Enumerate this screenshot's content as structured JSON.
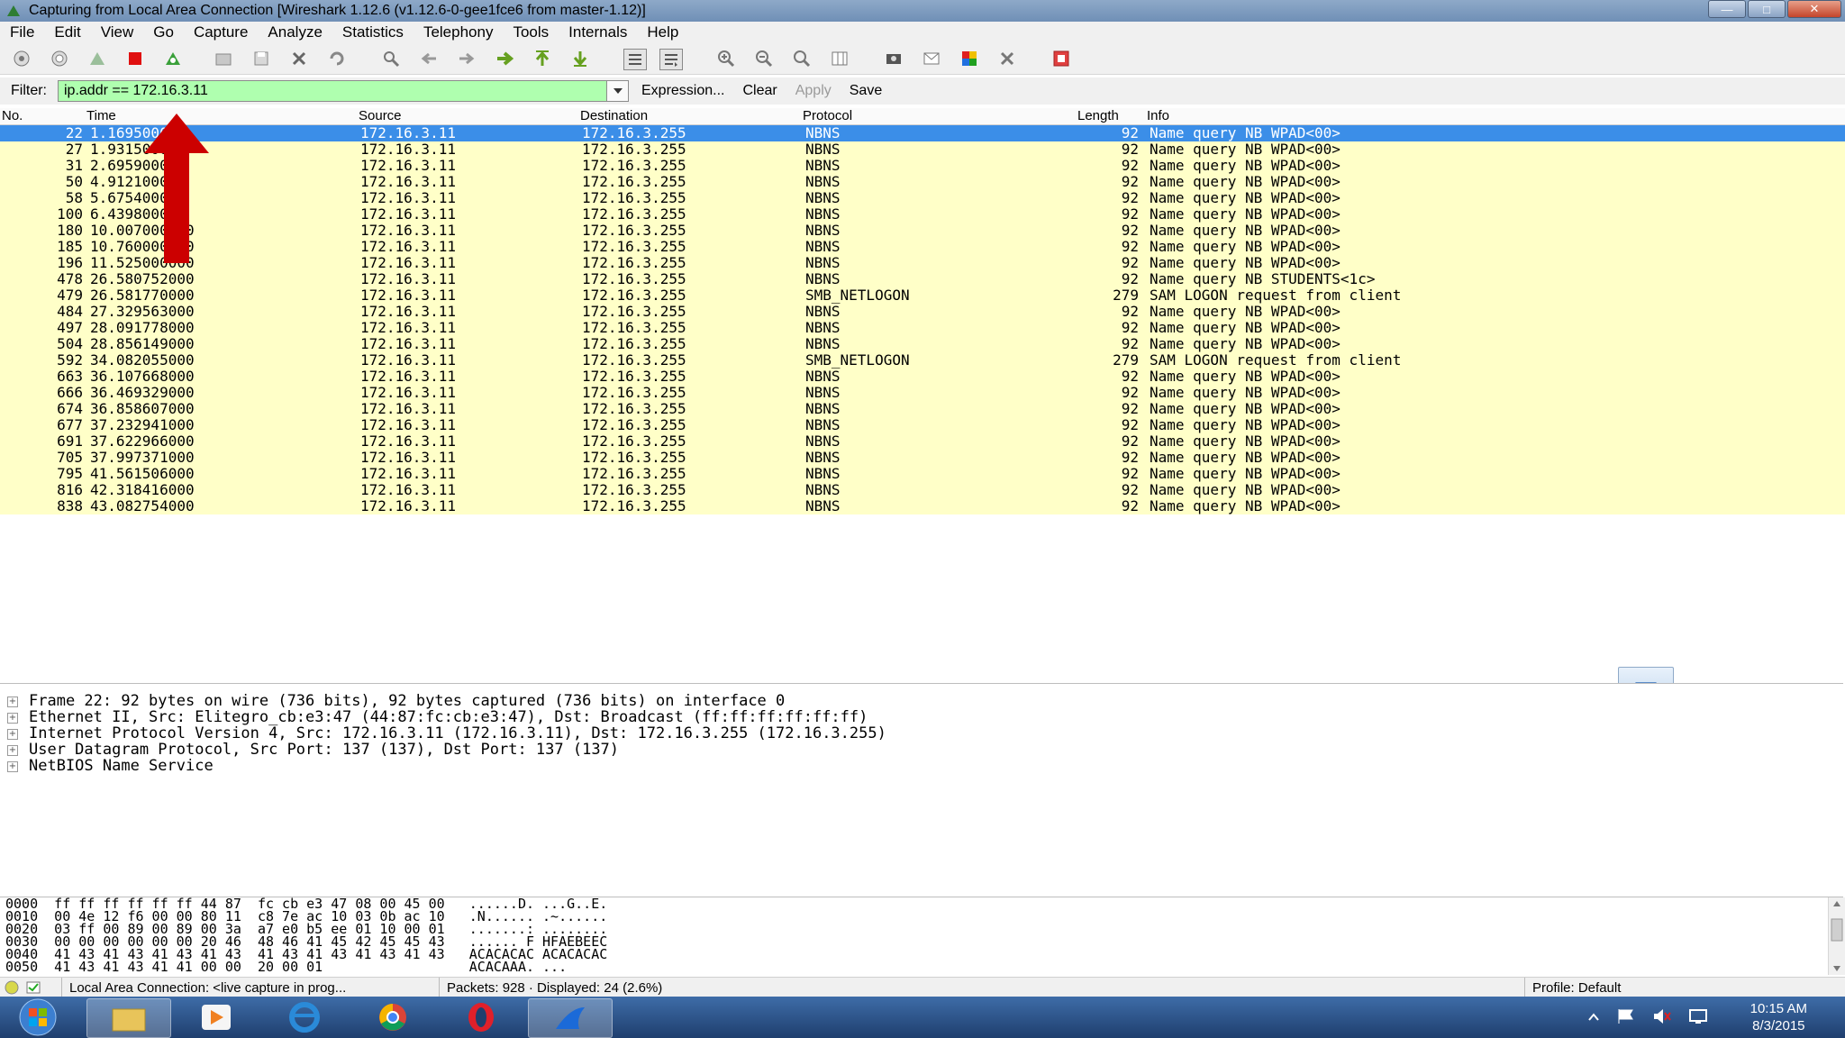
{
  "window": {
    "title": "Capturing from Local Area Connection   [Wireshark 1.12.6  (v1.12.6-0-gee1fce6 from master-1.12)]"
  },
  "menu": [
    "File",
    "Edit",
    "View",
    "Go",
    "Capture",
    "Analyze",
    "Statistics",
    "Telephony",
    "Tools",
    "Internals",
    "Help"
  ],
  "filter": {
    "label": "Filter:",
    "value": "ip.addr == 172.16.3.11",
    "expression": "Expression...",
    "clear": "Clear",
    "apply": "Apply",
    "save": "Save"
  },
  "columns": [
    "No.",
    "Time",
    "Source",
    "Destination",
    "Protocol",
    "Length",
    "Info"
  ],
  "packets": [
    {
      "no": "22",
      "time": "1.169500000",
      "src": "172.16.3.11",
      "dst": "172.16.3.255",
      "proto": "NBNS",
      "len": "92",
      "info": "Name query NB WPAD<00>"
    },
    {
      "no": "27",
      "time": "1.931500000",
      "src": "172.16.3.11",
      "dst": "172.16.3.255",
      "proto": "NBNS",
      "len": "92",
      "info": "Name query NB WPAD<00>"
    },
    {
      "no": "31",
      "time": "2.695900000",
      "src": "172.16.3.11",
      "dst": "172.16.3.255",
      "proto": "NBNS",
      "len": "92",
      "info": "Name query NB WPAD<00>"
    },
    {
      "no": "50",
      "time": "4.912100000",
      "src": "172.16.3.11",
      "dst": "172.16.3.255",
      "proto": "NBNS",
      "len": "92",
      "info": "Name query NB WPAD<00>"
    },
    {
      "no": "58",
      "time": "5.675400000",
      "src": "172.16.3.11",
      "dst": "172.16.3.255",
      "proto": "NBNS",
      "len": "92",
      "info": "Name query NB WPAD<00>"
    },
    {
      "no": "100",
      "time": "6.439800000",
      "src": "172.16.3.11",
      "dst": "172.16.3.255",
      "proto": "NBNS",
      "len": "92",
      "info": "Name query NB WPAD<00>"
    },
    {
      "no": "180",
      "time": "10.007000000",
      "src": "172.16.3.11",
      "dst": "172.16.3.255",
      "proto": "NBNS",
      "len": "92",
      "info": "Name query NB WPAD<00>"
    },
    {
      "no": "185",
      "time": "10.760000000",
      "src": "172.16.3.11",
      "dst": "172.16.3.255",
      "proto": "NBNS",
      "len": "92",
      "info": "Name query NB WPAD<00>"
    },
    {
      "no": "196",
      "time": "11.525000000",
      "src": "172.16.3.11",
      "dst": "172.16.3.255",
      "proto": "NBNS",
      "len": "92",
      "info": "Name query NB WPAD<00>"
    },
    {
      "no": "478",
      "time": "26.580752000",
      "src": "172.16.3.11",
      "dst": "172.16.3.255",
      "proto": "NBNS",
      "len": "92",
      "info": "Name query NB STUDENTS<1c>"
    },
    {
      "no": "479",
      "time": "26.581770000",
      "src": "172.16.3.11",
      "dst": "172.16.3.255",
      "proto": "SMB_NETLOGON",
      "len": "279",
      "info": "SAM LOGON request from client"
    },
    {
      "no": "484",
      "time": "27.329563000",
      "src": "172.16.3.11",
      "dst": "172.16.3.255",
      "proto": "NBNS",
      "len": "92",
      "info": "Name query NB WPAD<00>"
    },
    {
      "no": "497",
      "time": "28.091778000",
      "src": "172.16.3.11",
      "dst": "172.16.3.255",
      "proto": "NBNS",
      "len": "92",
      "info": "Name query NB WPAD<00>"
    },
    {
      "no": "504",
      "time": "28.856149000",
      "src": "172.16.3.11",
      "dst": "172.16.3.255",
      "proto": "NBNS",
      "len": "92",
      "info": "Name query NB WPAD<00>"
    },
    {
      "no": "592",
      "time": "34.082055000",
      "src": "172.16.3.11",
      "dst": "172.16.3.255",
      "proto": "SMB_NETLOGON",
      "len": "279",
      "info": "SAM LOGON request from client"
    },
    {
      "no": "663",
      "time": "36.107668000",
      "src": "172.16.3.11",
      "dst": "172.16.3.255",
      "proto": "NBNS",
      "len": "92",
      "info": "Name query NB WPAD<00>"
    },
    {
      "no": "666",
      "time": "36.469329000",
      "src": "172.16.3.11",
      "dst": "172.16.3.255",
      "proto": "NBNS",
      "len": "92",
      "info": "Name query NB WPAD<00>"
    },
    {
      "no": "674",
      "time": "36.858607000",
      "src": "172.16.3.11",
      "dst": "172.16.3.255",
      "proto": "NBNS",
      "len": "92",
      "info": "Name query NB WPAD<00>"
    },
    {
      "no": "677",
      "time": "37.232941000",
      "src": "172.16.3.11",
      "dst": "172.16.3.255",
      "proto": "NBNS",
      "len": "92",
      "info": "Name query NB WPAD<00>"
    },
    {
      "no": "691",
      "time": "37.622966000",
      "src": "172.16.3.11",
      "dst": "172.16.3.255",
      "proto": "NBNS",
      "len": "92",
      "info": "Name query NB WPAD<00>"
    },
    {
      "no": "705",
      "time": "37.997371000",
      "src": "172.16.3.11",
      "dst": "172.16.3.255",
      "proto": "NBNS",
      "len": "92",
      "info": "Name query NB WPAD<00>"
    },
    {
      "no": "795",
      "time": "41.561506000",
      "src": "172.16.3.11",
      "dst": "172.16.3.255",
      "proto": "NBNS",
      "len": "92",
      "info": "Name query NB WPAD<00>"
    },
    {
      "no": "816",
      "time": "42.318416000",
      "src": "172.16.3.11",
      "dst": "172.16.3.255",
      "proto": "NBNS",
      "len": "92",
      "info": "Name query NB WPAD<00>"
    },
    {
      "no": "838",
      "time": "43.082754000",
      "src": "172.16.3.11",
      "dst": "172.16.3.255",
      "proto": "NBNS",
      "len": "92",
      "info": "Name query NB WPAD<00>"
    }
  ],
  "details": [
    "Frame 22: 92 bytes on wire (736 bits), 92 bytes captured (736 bits) on interface 0",
    "Ethernet II, Src: Elitegro_cb:e3:47 (44:87:fc:cb:e3:47), Dst: Broadcast (ff:ff:ff:ff:ff:ff)",
    "Internet Protocol Version 4, Src: 172.16.3.11 (172.16.3.11), Dst: 172.16.3.255 (172.16.3.255)",
    "User Datagram Protocol, Src Port: 137 (137), Dst Port: 137 (137)",
    "NetBIOS Name Service"
  ],
  "bytes": [
    "0000  ff ff ff ff ff ff 44 87  fc cb e3 47 08 00 45 00   ......D. ...G..E.",
    "0010  00 4e 12 f6 00 00 80 11  c8 7e ac 10 03 0b ac 10   .N...... .~......",
    "0020  03 ff 00 89 00 89 00 3a  a7 e0 b5 ee 01 10 00 01   .......: ........",
    "0030  00 00 00 00 00 00 20 46  48 46 41 45 42 45 45 43   ...... F HFAEBEEC",
    "0040  41 43 41 43 41 43 41 43  41 43 41 43 41 43 41 43   ACACACAC ACACACAC",
    "0050  41 43 41 43 41 41 00 00  20 00 01                  ACACAAA. ...     "
  ],
  "status": {
    "interface": "Local Area Connection: <live capture in prog...",
    "packets": "Packets: 928 · Displayed: 24 (2.6%)",
    "profile": "Profile: Default"
  },
  "clock": {
    "time": "10:15 AM",
    "date": "8/3/2015"
  },
  "colors": {
    "row": "#ffffc8",
    "selected": "#3b8ee8",
    "filter_ok": "#afffaf",
    "arrow": "#cc0000"
  }
}
